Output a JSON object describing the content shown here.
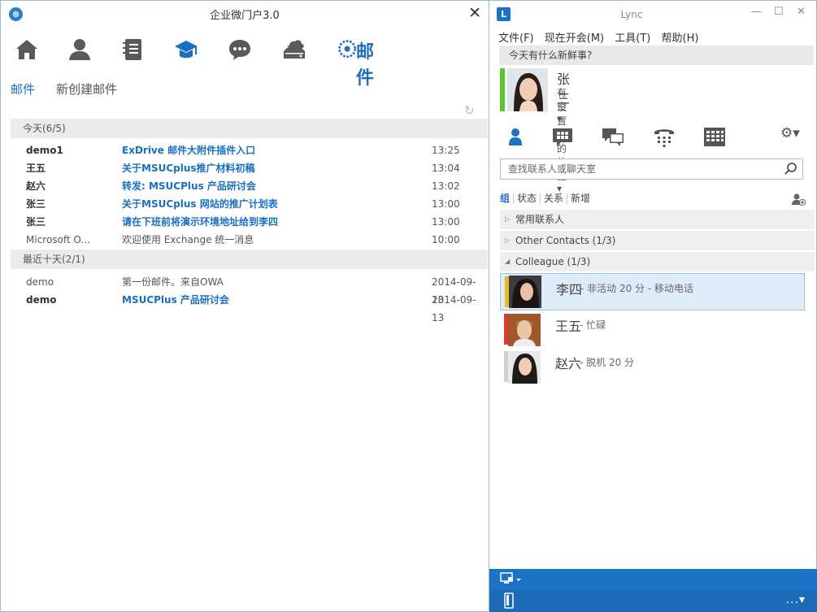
{
  "left_window": {
    "title": "企业微门户3.0",
    "close_glyph": "✕",
    "modules": [
      {
        "name": "home",
        "icon": "home-icon"
      },
      {
        "name": "contacts",
        "icon": "person-icon"
      },
      {
        "name": "notebook",
        "icon": "notebook-icon"
      },
      {
        "name": "learning",
        "icon": "graduation-cap-icon"
      },
      {
        "name": "chat",
        "icon": "chat-bubble-icon"
      },
      {
        "name": "cloud-drive",
        "icon": "cloud-drive-icon"
      },
      {
        "name": "mail",
        "icon": "mail-module-icon",
        "label": "邮件"
      }
    ],
    "tabs": {
      "mail": "邮件",
      "compose": "新创建邮件"
    },
    "groups": [
      {
        "label": "今天(6/5)",
        "rows": [
          {
            "from": "demo1",
            "subject": "ExDrive 邮件大附件插件入口",
            "time": "13:25",
            "unread": true
          },
          {
            "from": "王五",
            "subject": "关于MSUCplus推广材料初稿",
            "time": "13:04",
            "unread": true
          },
          {
            "from": "赵六",
            "subject": "转发: MSUCPlus 产品研讨会",
            "time": "13:02",
            "unread": true
          },
          {
            "from": "张三",
            "subject": "关于MSUCplus 网站的推广计划表",
            "time": "13:00",
            "unread": true
          },
          {
            "from": "张三",
            "subject": "请在下班前将演示环境地址给到李四",
            "time": "13:00",
            "unread": true
          },
          {
            "from": "Microsoft O...",
            "subject": "欢迎使用 Exchange 统一消息",
            "time": "10:00",
            "unread": false
          }
        ]
      },
      {
        "label": "最近十天(2/1)",
        "rows": [
          {
            "from": "demo",
            "subject": "第一份邮件。来自OWA",
            "time": "2014-09-13",
            "unread": false
          },
          {
            "from": "demo",
            "subject": "MSUCPlus 产品研讨会",
            "time": "2014-09-13",
            "unread": true
          }
        ]
      }
    ]
  },
  "right_window": {
    "title": "Lync",
    "menu": [
      "文件(F)",
      "现在开会(M)",
      "工具(T)",
      "帮助(H)"
    ],
    "whats_new_placeholder": "今天有什么新鲜事?",
    "me": {
      "name": "张三",
      "status": "有空",
      "location": "设置您的位置",
      "presence_color": "#5cc42b"
    },
    "search_placeholder": "查找联系人或聊天室",
    "contact_tabs": [
      "组",
      "状态",
      "关系",
      "新增"
    ],
    "groups": [
      {
        "name": "常用联系人",
        "expanded": false
      },
      {
        "name": "Other Contacts (1/3)",
        "expanded": false
      },
      {
        "name": "Colleague (1/3)",
        "expanded": true
      }
    ],
    "contacts": [
      {
        "name": "李四",
        "info": "- 非活动 20 分 - 移动电话",
        "presence_color": "#e8b82a",
        "selected": true
      },
      {
        "name": "王五",
        "info": "- 忙碌",
        "presence_color": "#d83b2f",
        "selected": false
      },
      {
        "name": "赵六",
        "info": "- 脱机 20 分",
        "presence_color": "#cfcfcf",
        "selected": false
      }
    ],
    "bottom": {
      "more": "..."
    },
    "accent_color": "#1b73c5"
  }
}
